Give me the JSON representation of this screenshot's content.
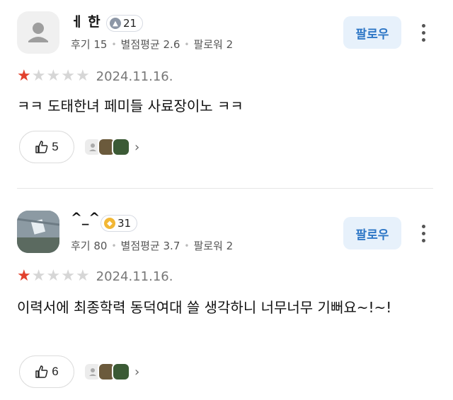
{
  "reviews": [
    {
      "nickname": "ㅔ 한",
      "level": "21",
      "stats": {
        "reviews": "후기 15",
        "avg": "별점평균 2.6",
        "followers": "팔로워 2"
      },
      "follow_label": "팔로우",
      "rating": 1,
      "date": "2024.11.16.",
      "content": "ㅋㅋ 도태한녀 페미들 사료장이노 ㅋㅋ",
      "likes": "5"
    },
    {
      "nickname": "^_^",
      "level": "31",
      "stats": {
        "reviews": "후기 80",
        "avg": "별점평균 3.7",
        "followers": "팔로워 2"
      },
      "follow_label": "팔로우",
      "rating": 1,
      "date": "2024.11.16.",
      "content": "이력서에 최종학력 동덕여대 쓸 생각하니 너무너무 기뻐요~!~!",
      "likes": "6"
    }
  ],
  "colors": {
    "accent": "#2e77c6",
    "follow_bg": "#e7f1fb",
    "star_on": "#e2402c",
    "star_off": "#d6d6d6"
  }
}
